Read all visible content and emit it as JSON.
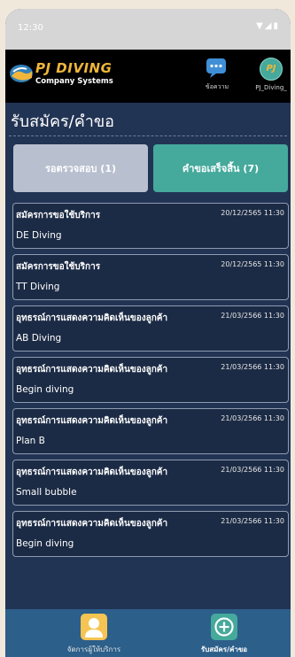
{
  "status": {
    "time": "12:30",
    "icons": "▼◢▮"
  },
  "brand": {
    "title": "PJ DIVING",
    "subtitle": "Company Systems"
  },
  "nav": {
    "messages_label": "ข้อความ",
    "user_label": "PJ_Diving_",
    "user_initials": "PJ"
  },
  "page": {
    "title": "รับสมัคร/คำขอ"
  },
  "tabs": {
    "pending": "รอตรวจสอบ (1)",
    "done": "คำขอเสร็จสิ้น (7)"
  },
  "requests": [
    {
      "title": "สมัครการขอใช้บริการ",
      "date": "20/12/2565 11:30",
      "name": "DE Diving"
    },
    {
      "title": "สมัครการขอใช้บริการ",
      "date": "20/12/2565 11:30",
      "name": "TT Diving"
    },
    {
      "title": "อุทธรณ์การแสดงความคิดเห็นของลูกค้า",
      "date": "21/03/2566 11:30",
      "name": "AB Diving"
    },
    {
      "title": "อุทธรณ์การแสดงความคิดเห็นของลูกค้า",
      "date": "21/03/2566 11:30",
      "name": "Begin diving"
    },
    {
      "title": "อุทธรณ์การแสดงความคิดเห็นของลูกค้า",
      "date": "21/03/2566 11:30",
      "name": "Plan B"
    },
    {
      "title": "อุทธรณ์การแสดงความคิดเห็นของลูกค้า",
      "date": "21/03/2566 11:30",
      "name": "Small bubble"
    },
    {
      "title": "อุทธรณ์การแสดงความคิดเห็นของลูกค้า",
      "date": "21/03/2566 11:30",
      "name": "Begin diving"
    }
  ],
  "bottom_nav": {
    "providers": "จัดการผู้ให้บริการ",
    "requests": "รับสมัคร/คำขอ"
  },
  "colors": {
    "background": "#223454",
    "accent": "#45a99c",
    "brand": "#f0b63b",
    "bottom_bar": "#2c5f8a"
  },
  "icons": {
    "logo": "diving-logo-icon",
    "messages": "chat-icon",
    "provider": "person-icon",
    "add": "plus-circle-icon"
  }
}
